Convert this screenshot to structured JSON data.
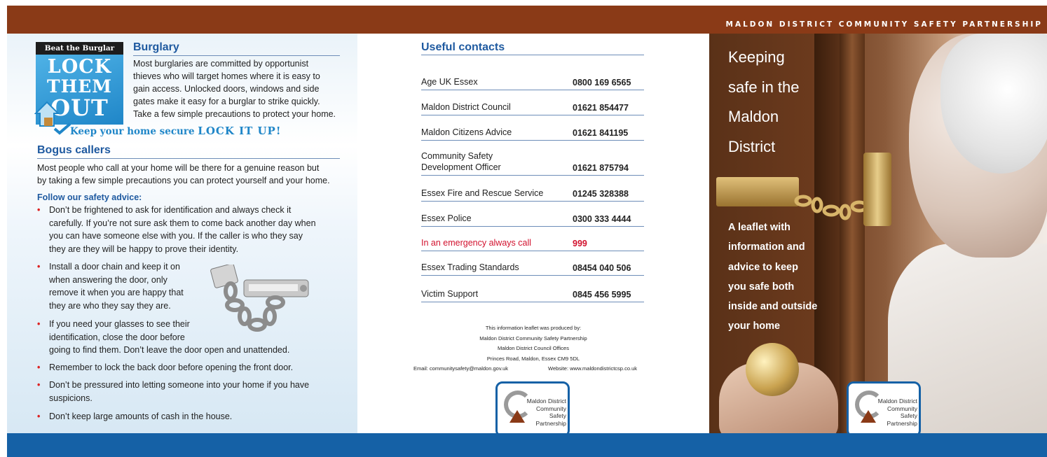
{
  "header": {
    "org": "MALDON DISTRICT COMMUNITY SAFETY PARTNERSHIP"
  },
  "left": {
    "logo": {
      "beat": "Beat the Burglar",
      "line1": "LOCK",
      "line2": "THEM",
      "line3": "OUT"
    },
    "burglary": {
      "heading": "Burglary",
      "lines": [
        "Most burglaries are committed by opportunist",
        "thieves who will target homes where it is easy to",
        "gain access.  Unlocked doors, windows and side",
        "gates make it easy for a burglar to strike quickly.",
        "Take a few simple precautions to protect your home."
      ]
    },
    "slogan": {
      "small": "Keep your home secure",
      "big": "LOCK IT UP!"
    },
    "bogus": {
      "heading": "Bogus callers",
      "lines": [
        "Most people who call at your home will be there for a genuine reason but",
        "by taking a few simple precautions you can protect yourself and your home."
      ],
      "advice_heading": "Follow our safety advice:",
      "bullets": [
        [
          "Don’t be frightened to ask for identification and always check it",
          "carefully.  If you’re not sure ask them to come back another day when",
          "you can have someone else with you.  If the caller is who they say",
          "they are they will be happy to prove their identity."
        ],
        [
          "Install a door chain and keep it on",
          "when answering the door, only",
          "remove it when you are happy that",
          "they are who they say they are."
        ],
        [
          "If you need your glasses to see their",
          "identification, close the door before",
          "going to find them. Don’t leave the door open and unattended."
        ],
        [
          "Remember to lock the back door before opening the front door."
        ],
        [
          "Don’t be pressured into letting someone into your home if you have",
          "suspicions."
        ],
        [
          "Don’t keep large amounts of cash in the house."
        ]
      ]
    }
  },
  "middle": {
    "heading": "Useful contacts",
    "contacts": [
      {
        "name": "Age UK Essex",
        "phone": "0800 169 6565"
      },
      {
        "name": "Maldon District Council",
        "phone": "01621 854477"
      },
      {
        "name": "Maldon Citizens Advice",
        "phone": "01621 841195"
      },
      {
        "name_lines": [
          "Community Safety",
          "Development Officer"
        ],
        "phone": "01621 875794"
      },
      {
        "name": "Essex Fire and Rescue Service",
        "phone": "01245 328388"
      },
      {
        "name": "Essex Police",
        "phone": "0300 333 4444"
      },
      {
        "name": "In an emergency always call",
        "phone": "999",
        "emergency": true
      },
      {
        "name": "Essex Trading Standards",
        "phone": "08454 040 506"
      },
      {
        "name": "Victim Support",
        "phone": "0845 456 5995"
      }
    ],
    "produced": [
      "This information leaflet was produced by:",
      "Maldon District Community Safety Partnership",
      "Maldon District Council Offices",
      "Princes Road, Maldon, Essex CM9 5DL"
    ],
    "email": "Email: communitysafety@maldon.gov.uk",
    "website": "Website: www.maldondistrictcsp.co.uk"
  },
  "logo_text": [
    "Maldon District",
    "Community",
    "Safety",
    "Partnership"
  ],
  "right": {
    "title_lines": [
      "Keeping",
      "safe in the",
      "Maldon",
      "District"
    ],
    "desc_lines": [
      "A leaflet with",
      "information and",
      "advice to keep",
      "you safe both",
      "inside and outside",
      "your home"
    ]
  },
  "colors": {
    "topbar": "#8a3a17",
    "bottombar": "#1561a6",
    "heading_blue": "#1f5aa0",
    "emergency_red": "#d2122e"
  }
}
